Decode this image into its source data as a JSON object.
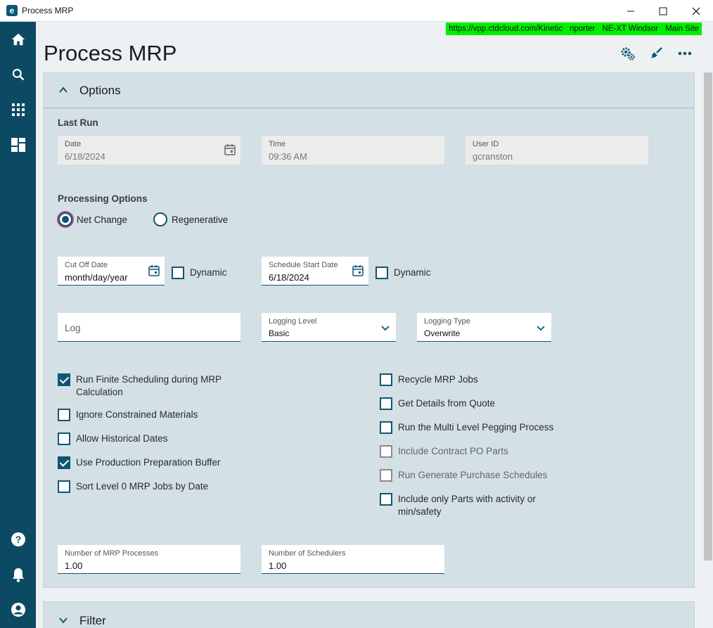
{
  "window": {
    "title": "Process MRP",
    "app_icon": "e",
    "minimize": "—",
    "maximize": "☐",
    "close": "✕"
  },
  "rail": {
    "items": [
      "home-icon",
      "search-icon",
      "apps-grid-icon",
      "dashboard-icon",
      "help-icon",
      "notifications-icon",
      "user-account-icon"
    ]
  },
  "env": {
    "url": "https://vpp.ctdcloud.com/Kinetic",
    "user": "nporter",
    "company": "NE-XT Windsor",
    "site": "Main Site",
    "color": "#00ee00"
  },
  "page": {
    "title": "Process MRP",
    "header_icons": [
      "settings-gears-icon",
      "clear-broom-icon",
      "more-options-icon"
    ]
  },
  "options": {
    "title": "Options",
    "last_run": {
      "label": "Last Run",
      "date_label": "Date",
      "date_value": "6/18/2024",
      "time_label": "Time",
      "time_value": "09:36 AM",
      "user_label": "User ID",
      "user_value": "gcranston"
    },
    "processing": {
      "label": "Processing Options",
      "net_change": "Net Change",
      "regenerative": "Regenerative",
      "selected": "Net Change"
    },
    "cutoff": {
      "label": "Cut Off Date",
      "placeholder": "month/day/year",
      "dynamic_label": "Dynamic"
    },
    "schedule_start": {
      "label": "Schedule Start Date",
      "value": "6/18/2024",
      "dynamic_label": "Dynamic"
    },
    "log": {
      "placeholder": "Log"
    },
    "logging_level": {
      "label": "Logging Level",
      "value": "Basic"
    },
    "logging_type": {
      "label": "Logging Type",
      "value": "Overwrite"
    },
    "left_checks": [
      {
        "line1": "Run Finite Scheduling during MRP",
        "line2": "Calculation",
        "checked": true
      },
      {
        "line1": "Ignore Constrained Materials",
        "line2": "",
        "checked": false
      },
      {
        "line1": "Allow Historical Dates",
        "line2": "",
        "checked": false
      },
      {
        "line1": "Use Production Preparation Buffer",
        "line2": "",
        "checked": true
      },
      {
        "line1": "Sort Level 0 MRP Jobs by Date",
        "line2": "",
        "checked": false
      }
    ],
    "right_checks": [
      {
        "line1": "Recycle MRP Jobs",
        "line2": "",
        "checked": false,
        "disabled": false
      },
      {
        "line1": "Get Details from Quote",
        "line2": "",
        "checked": false,
        "disabled": false
      },
      {
        "line1": "Run the Multi Level Pegging Process",
        "line2": "",
        "checked": false,
        "disabled": false
      },
      {
        "line1": "Include Contract PO Parts",
        "line2": "",
        "checked": false,
        "disabled": true
      },
      {
        "line1": "Run Generate Purchase Schedules",
        "line2": "",
        "checked": false,
        "disabled": true
      },
      {
        "line1": "Include only Parts with activity or",
        "line2": "min/safety",
        "checked": false,
        "disabled": false
      }
    ],
    "num_processes": {
      "label": "Number of MRP Processes",
      "value": "1.00"
    },
    "num_schedulers": {
      "label": "Number of Schedulers",
      "value": "1.00"
    }
  },
  "filter": {
    "title": "Filter"
  },
  "colors": {
    "rail": "#0c4a63",
    "accent": "#0e5575",
    "panel": "#d3e0e5"
  }
}
